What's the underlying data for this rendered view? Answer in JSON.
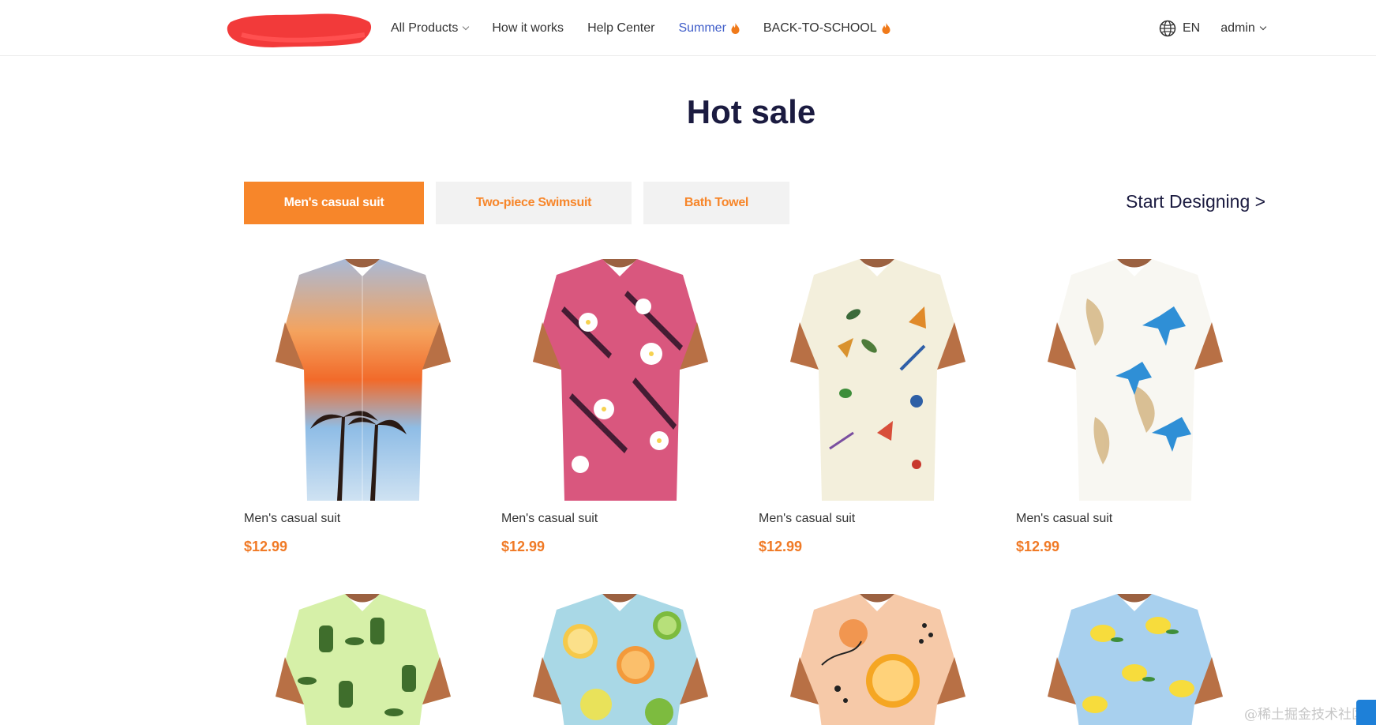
{
  "header": {
    "nav": [
      {
        "label": "All Products",
        "has_dropdown": true
      },
      {
        "label": "How it works"
      },
      {
        "label": "Help Center"
      },
      {
        "label": "Summer",
        "icon": "flame-icon",
        "accent": "#3f5dc9"
      },
      {
        "label": "BACK-TO-SCHOOL",
        "icon": "flame-icon"
      }
    ],
    "language": "EN",
    "user": "admin"
  },
  "page_title": "Hot sale",
  "tabs": [
    {
      "label": "Men's casual suit",
      "active": true
    },
    {
      "label": "Two-piece Swimsuit",
      "active": false
    },
    {
      "label": "Bath Towel",
      "active": false
    }
  ],
  "start_designing": "Start Designing >",
  "products": [
    {
      "name": "Men's casual suit",
      "price": "$12.99",
      "pattern": "sunset-palm-print"
    },
    {
      "name": "Men's casual suit",
      "price": "$12.99",
      "pattern": "pink-tropical-leaf-print"
    },
    {
      "name": "Men's casual suit",
      "price": "$12.99",
      "pattern": "insect-print"
    },
    {
      "name": "Men's casual suit",
      "price": "$12.99",
      "pattern": "blue-lily-print"
    },
    {
      "pattern": "pickle-jar-print"
    },
    {
      "pattern": "citrus-kiwi-print"
    },
    {
      "pattern": "orange-abstract-print"
    },
    {
      "pattern": "lemon-print"
    }
  ],
  "colors": {
    "accent_orange": "#f7862a",
    "price_orange": "#f07a26",
    "title_navy": "#1b1b40",
    "link_blue": "#3f5dc9"
  },
  "watermark": "@稀土掘金技术社区"
}
